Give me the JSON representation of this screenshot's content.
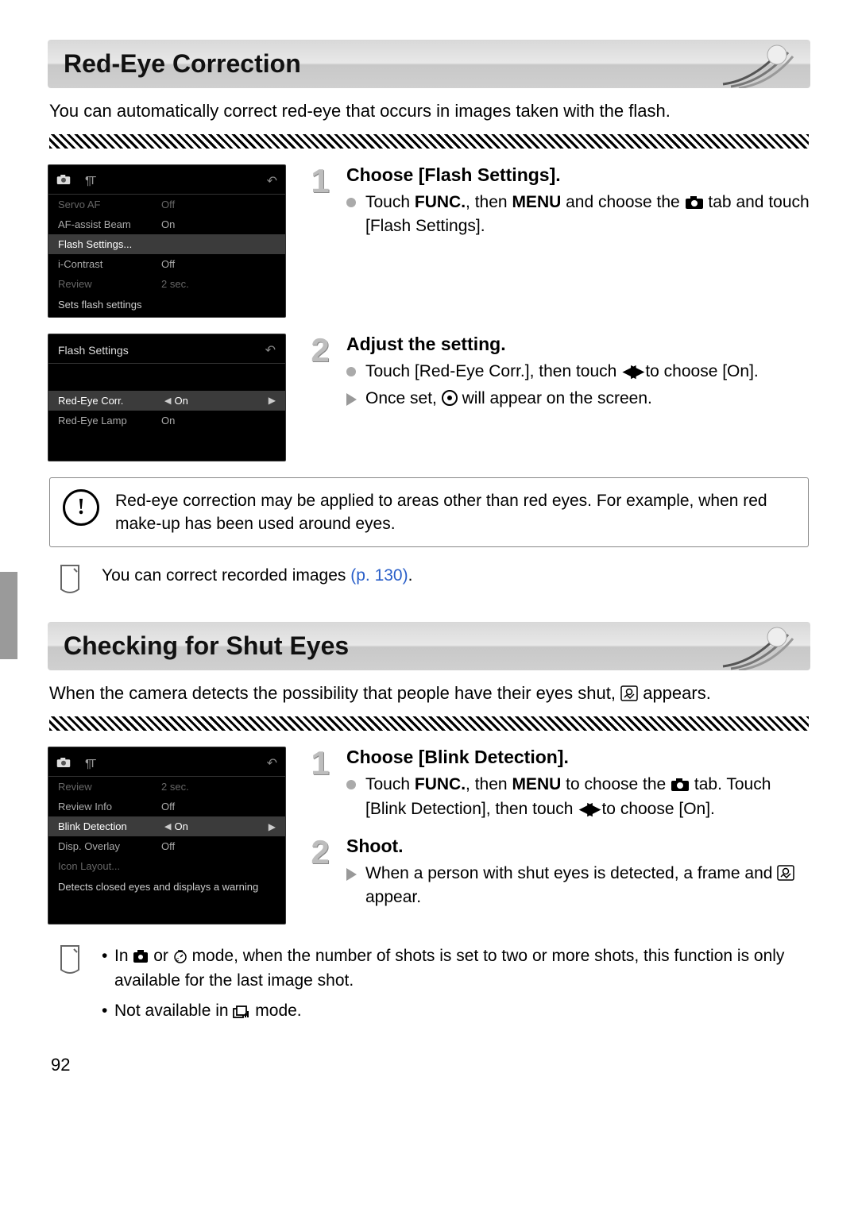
{
  "page_number": "92",
  "section1": {
    "title": "Red-Eye Correction",
    "intro": "You can automatically correct red-eye that occurs in images taken with the flash.",
    "lcd1": {
      "rows": [
        {
          "label": "Servo AF",
          "val": "Off",
          "dim": true
        },
        {
          "label": "AF-assist Beam",
          "val": "On"
        },
        {
          "label": "Flash Settings...",
          "val": "",
          "sel": true
        },
        {
          "label": "i-Contrast",
          "val": "Off"
        },
        {
          "label": "Review",
          "val": "2 sec.",
          "dim": true
        }
      ],
      "caption": "Sets flash settings"
    },
    "lcd2": {
      "title": "Flash Settings",
      "rows": [
        {
          "label": "Red-Eye Corr.",
          "val": "On",
          "sel": true,
          "arrows": true
        },
        {
          "label": "Red-Eye Lamp",
          "val": "On"
        }
      ]
    },
    "step1": {
      "heading": "Choose [Flash Settings].",
      "line_a": "Touch ",
      "func": "FUNC.",
      "line_b": ", then ",
      "menu": "MENU",
      "line_c": " and choose the ",
      "line_d": " tab and touch [Flash Settings]."
    },
    "step2": {
      "heading": "Adjust the setting.",
      "b1a": "Touch [Red-Eye Corr.], then touch ",
      "b1b": " to choose [On].",
      "b2a": "Once set, ",
      "b2b": " will appear on the screen."
    },
    "warn": "Red-eye correction may be applied to areas other than red eyes. For example, when red make-up has been used around eyes.",
    "tip_a": "You can correct recorded images ",
    "tip_link": "(p. 130)",
    "tip_b": "."
  },
  "section2": {
    "title": "Checking for Shut Eyes",
    "intro_a": "When the camera detects the possibility that people have their eyes shut, ",
    "intro_b": " appears.",
    "lcd": {
      "rows": [
        {
          "label": "Review",
          "val": "2 sec.",
          "dim": true
        },
        {
          "label": "Review Info",
          "val": "Off"
        },
        {
          "label": "Blink Detection",
          "val": "On",
          "sel": true,
          "arrows": true
        },
        {
          "label": "Disp. Overlay",
          "val": "Off"
        },
        {
          "label": "Icon Layout...",
          "val": "",
          "dim": true
        }
      ],
      "caption": "Detects closed eyes and displays a warning"
    },
    "step1": {
      "heading": "Choose [Blink Detection].",
      "a": "Touch ",
      "func": "FUNC.",
      "b": ", then ",
      "menu": "MENU",
      "c": " to choose the ",
      "d": " tab. Touch [Blink Detection], then touch ",
      "e": " to choose [On]."
    },
    "step2": {
      "heading": "Shoot.",
      "a": "When a person with shut eyes is detected, a frame and ",
      "b": " appear."
    },
    "notes": {
      "n1a": "In ",
      "n1b": " or ",
      "n1c": " mode, when the number of shots is set to two or more shots, this function is only available for the last image shot.",
      "n2a": "Not available in ",
      "n2b": " mode."
    }
  }
}
